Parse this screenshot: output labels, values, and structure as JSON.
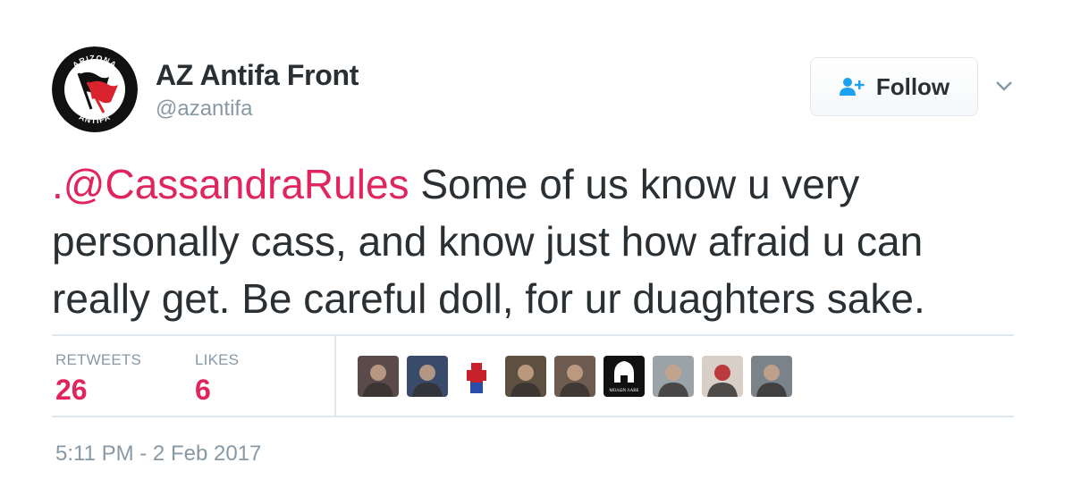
{
  "author": {
    "display_name": "AZ Antifa Front",
    "handle": "@azantifa",
    "avatar": {
      "icon": "antifa-flags-logo",
      "ring_text_top": "ARIZONA",
      "ring_text_bottom": "ANTIFA"
    }
  },
  "follow_button": {
    "label": "Follow",
    "icon": "add-user-icon"
  },
  "menu_caret": {
    "icon": "chevron-down-icon"
  },
  "tweet": {
    "lines": [
      {
        "mention": ".@CassandraRules",
        "text": " Some of us know u very"
      },
      {
        "text": "personally cass, and know just how afraid u can"
      },
      {
        "text": "really get. Be careful doll, for ur duaghters sake."
      }
    ]
  },
  "stats": {
    "retweets": {
      "label": "RETWEETS",
      "value": "26"
    },
    "likes": {
      "label": "LIKES",
      "value": "6"
    }
  },
  "likers": [
    {
      "name": "liker-avatar-1",
      "bg": "#5a4a4a"
    },
    {
      "name": "liker-avatar-2",
      "bg": "#3a4a6a"
    },
    {
      "name": "liker-avatar-3",
      "bg": "#ffffff"
    },
    {
      "name": "liker-avatar-4",
      "bg": "#5e5040"
    },
    {
      "name": "liker-avatar-5",
      "bg": "#6d5b4f"
    },
    {
      "name": "liker-avatar-6",
      "bg": "#111111",
      "text": "ΜΟΛΩΝ ΛΑΒΕ"
    },
    {
      "name": "liker-avatar-7",
      "bg": "#9aa3a8"
    },
    {
      "name": "liker-avatar-8",
      "bg": "#d8d0c8"
    },
    {
      "name": "liker-avatar-9",
      "bg": "#7a828a"
    }
  ],
  "timestamp": "5:11 PM - 2 Feb 2017",
  "colors": {
    "mention": "#e0245e",
    "likes_value": "#e0245e",
    "muted": "#8899a6",
    "text": "#292f33",
    "divider": "#e1e8ed",
    "follow_icon": "#1da1f2"
  }
}
